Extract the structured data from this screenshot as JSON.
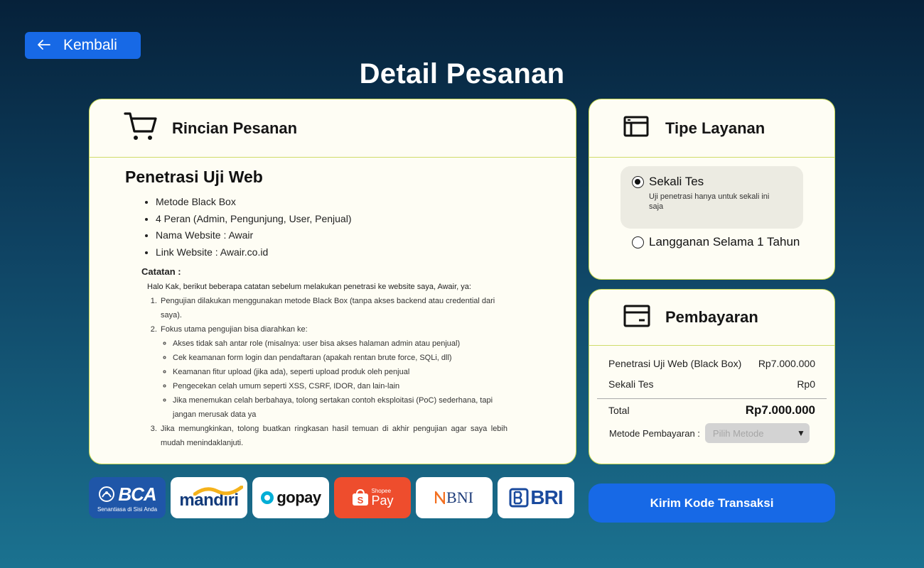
{
  "nav": {
    "back_label": "Kembali"
  },
  "page": {
    "title": "Detail Pesanan"
  },
  "order": {
    "header": "Rincian Pesanan",
    "service_name": "Penetrasi Uji Web",
    "features": [
      "Metode Black Box",
      "4 Peran (Admin, Pengunjung, User,  Penjual)",
      "Nama Website : Awair",
      "Link Website : Awair.co.id"
    ],
    "notes_title": "Catatan :",
    "notes_intro": "Halo Kak, berikut beberapa catatan sebelum melakukan penetrasi ke website saya, Awair, ya:",
    "notes": {
      "item1": "Pengujian dilakukan menggunakan metode Black Box (tanpa akses backend atau credential dari saya).",
      "item2": "Fokus utama pengujian bisa diarahkan ke:",
      "item2_sub": [
        "Akses tidak sah antar role (misalnya: user bisa akses halaman admin atau penjual)",
        "Cek keamanan form login dan pendaftaran (apakah rentan brute force, SQLi, dll)",
        "Keamanan fitur upload (jika ada), seperti upload produk oleh penjual",
        "Pengecekan celah umum seperti XSS, CSRF, IDOR, dan lain-lain",
        "Jika menemukan celah berbahaya, tolong sertakan contoh eksploitasi (PoC) sederhana, tapi jangan merusak data ya"
      ],
      "item3": "Jika memungkinkan, tolong buatkan ringkasan hasil temuan di akhir pengujian agar saya lebih mudah menindaklanjuti."
    }
  },
  "service_type": {
    "header": "Tipe Layanan",
    "option1": {
      "label": "Sekali Tes",
      "desc": "Uji penetrasi hanya untuk sekali ini saja",
      "selected": true
    },
    "option2": {
      "label": "Langganan Selama 1 Tahun",
      "selected": false
    }
  },
  "payment": {
    "header": "Pembayaran",
    "rows": [
      {
        "label": "Penetrasi Uji Web (Black Box)",
        "value": "Rp7.000.000"
      },
      {
        "label": "Sekali Tes",
        "value": "Rp0"
      }
    ],
    "total_label": "Total",
    "total_value": "Rp7.000.000",
    "method_label": "Metode Pembayaran :",
    "method_placeholder": "Pilih Metode"
  },
  "submit": {
    "label": "Kirim Kode Transaksi"
  },
  "banks": {
    "bca": {
      "name": "BCA",
      "tagline": "Senantiasa di Sisi Anda"
    },
    "mandiri": {
      "name": "mandiri"
    },
    "gopay": {
      "name": "gopay"
    },
    "shopeepay": {
      "name_top": "Shopee",
      "name_bottom": "Pay"
    },
    "bni": {
      "name": "BNI"
    },
    "bri": {
      "name": "BRI"
    }
  },
  "colors": {
    "primary": "#1769e6",
    "card_bg": "#fefdf4",
    "card_border": "#c9d94e",
    "bca": "#1f56a8",
    "shopee": "#ee4d2d"
  }
}
